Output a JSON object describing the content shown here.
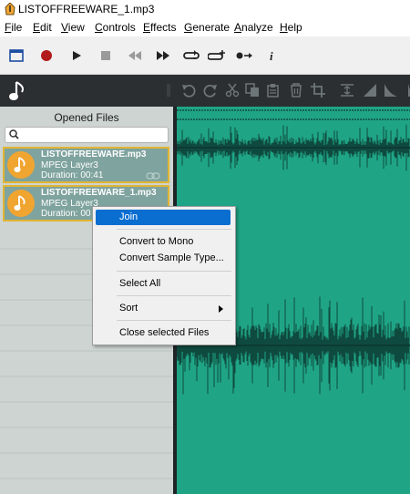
{
  "window": {
    "title": "LISTOFFREEWARE_1.mp3"
  },
  "menubar": {
    "items": [
      "File",
      "Edit",
      "View",
      "Controls",
      "Effects",
      "Generate",
      "Analyze",
      "Help"
    ]
  },
  "panel": {
    "title": "Opened Files",
    "search_placeholder": "",
    "files": [
      {
        "name": "LISTOFFREEWARE.mp3",
        "format": "MPEG Layer3",
        "duration": "Duration: 00:41"
      },
      {
        "name": "LISTOFFREEWARE_1.mp3",
        "format": "MPEG Layer3",
        "duration": "Duration: 00"
      }
    ]
  },
  "context_menu": {
    "items": [
      {
        "label": "Join",
        "selected": true
      },
      {
        "label": "Convert to Mono"
      },
      {
        "label": "Convert Sample Type..."
      },
      {
        "label": "Select All"
      },
      {
        "label": "Sort",
        "submenu": true
      },
      {
        "label": "Close selected Files"
      }
    ]
  },
  "colors": {
    "waveform_bg": "#1fa586",
    "waveform_fg": "#0d3b33",
    "selection": "#0a6ed1",
    "file_border": "#e1b533",
    "file_icon": "#f0a531"
  }
}
